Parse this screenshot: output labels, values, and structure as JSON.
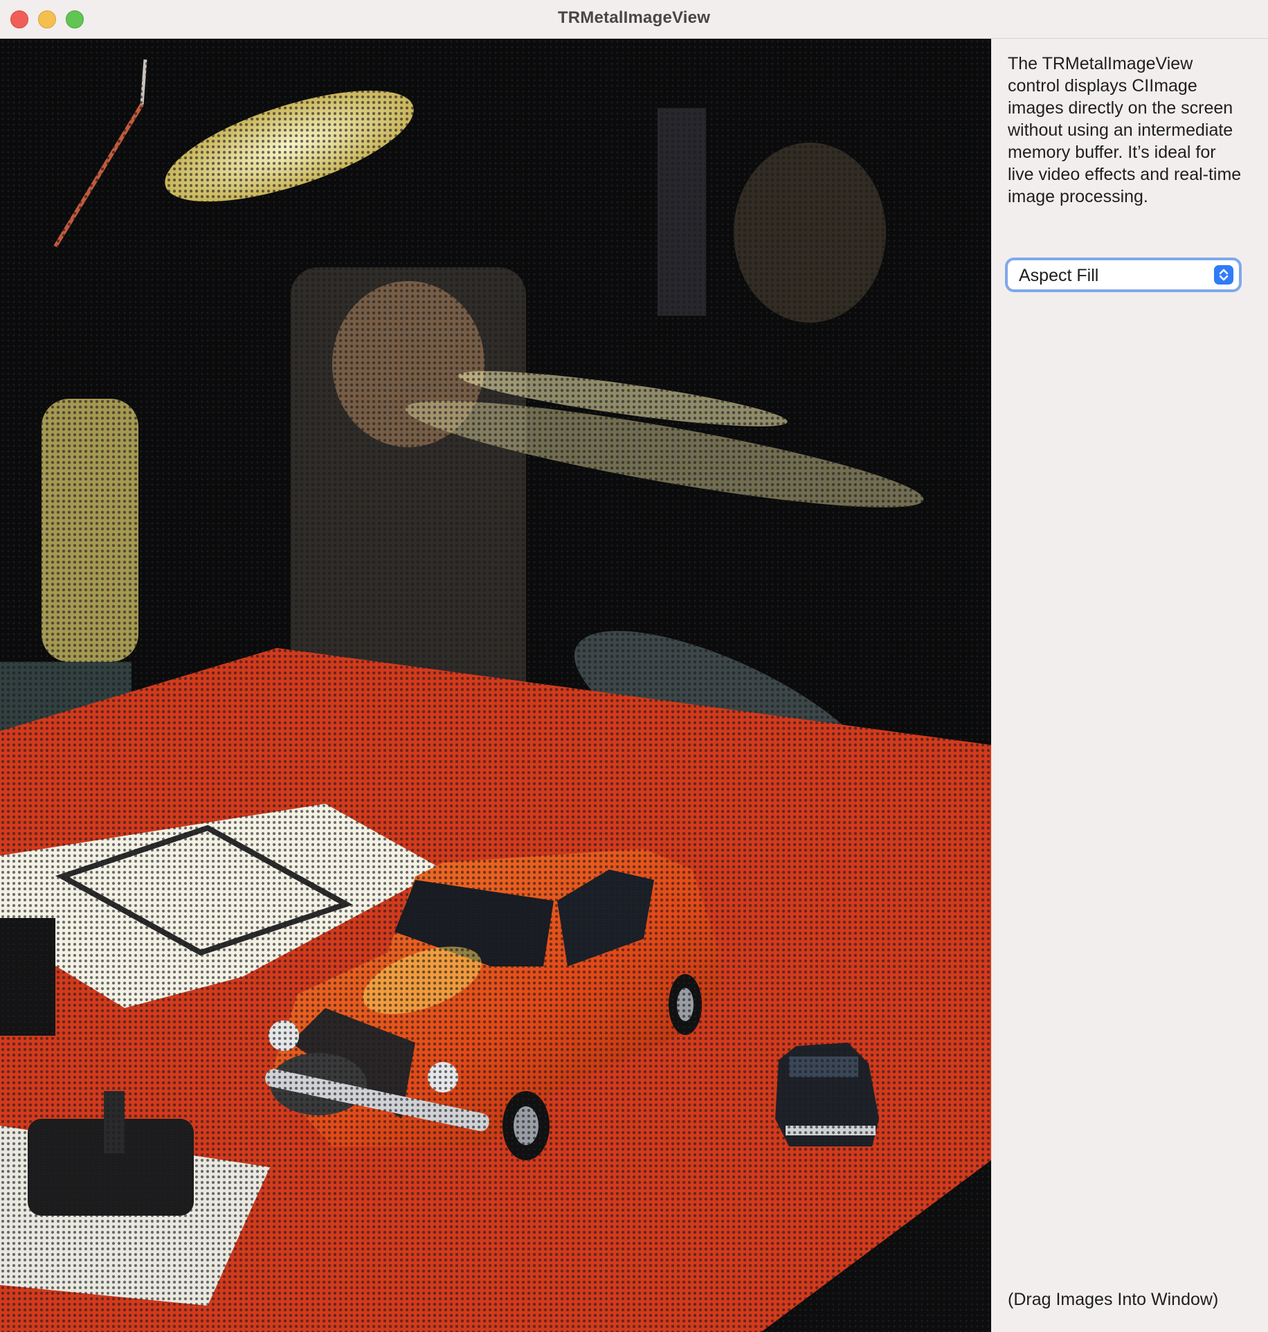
{
  "window": {
    "title": "TRMetalImageView"
  },
  "sidebar": {
    "description": "The TRMetalImageView control displays CIImage images directly on the screen without using an intermediate memory buffer. It’s ideal for live video effects and real-time image processing.",
    "content_mode_popup": {
      "selected": "Aspect Fill"
    },
    "drag_hint": "(Drag Images Into Window)"
  },
  "image": {
    "subject": "halftone-filtered photo of toy cars on a red table",
    "palette": {
      "background": "#0b0b0b",
      "table_red": "#d23a1c",
      "car_orange": "#e8501c",
      "highlight": "#f5f1c9",
      "accent_blue": "#2f7cf6"
    }
  },
  "icons": {
    "popup_arrows": "chevron-up-down-icon"
  }
}
